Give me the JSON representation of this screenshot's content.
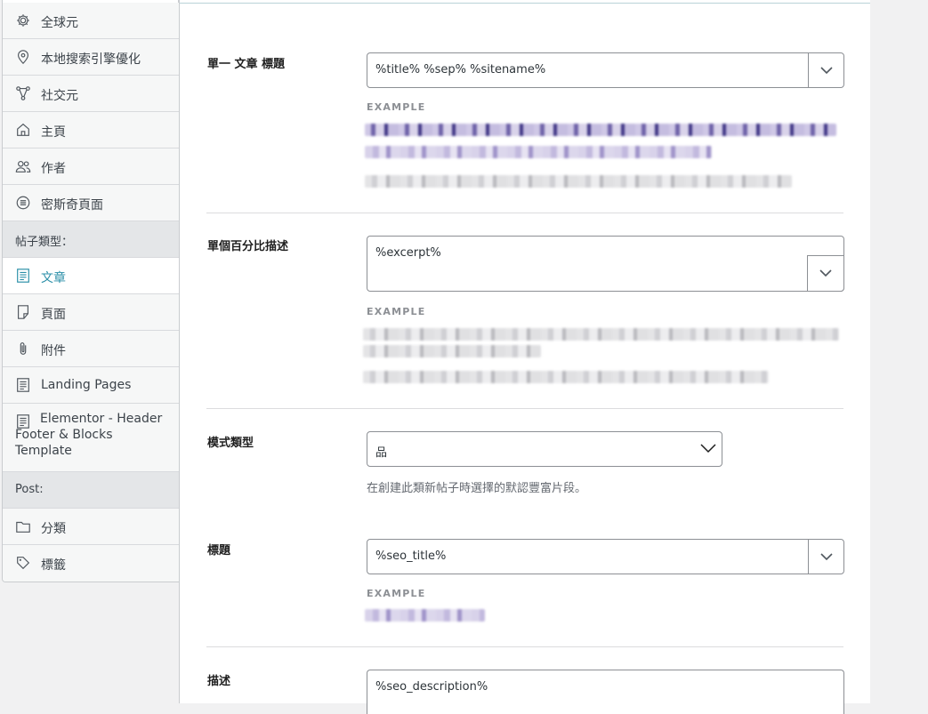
{
  "sidebar": {
    "items_top": [
      {
        "label": "全球元",
        "icon": "gear-icon"
      },
      {
        "label": "本地搜索引擎優化",
        "icon": "location-pin-icon"
      },
      {
        "label": "社交元",
        "icon": "share-nodes-icon"
      },
      {
        "label": "主頁",
        "icon": "home-icon"
      },
      {
        "label": "作者",
        "icon": "users-icon"
      },
      {
        "label": "密斯奇頁面",
        "icon": "circle-list-icon"
      }
    ],
    "section_post_types": "帖子類型：",
    "post_types": [
      {
        "label": "文章",
        "icon": "document-icon",
        "active": true
      },
      {
        "label": "頁面",
        "icon": "page-icon"
      },
      {
        "label": "附件",
        "icon": "paperclip-icon"
      },
      {
        "label": "Landing Pages",
        "icon": "document-icon"
      },
      {
        "label": "Elementor - Header Footer & Blocks Template",
        "icon": "document-icon"
      }
    ],
    "section_post": "Post:",
    "post_items": [
      {
        "label": "分類",
        "icon": "folder-icon"
      },
      {
        "label": "標籤",
        "icon": "tag-icon"
      }
    ]
  },
  "main": {
    "rows": [
      {
        "label": "單一 文章 標題",
        "value": "%title% %sep% %sitename%",
        "example_label": "EXAMPLE"
      },
      {
        "label": "單個百分比描述",
        "value": "%excerpt%",
        "example_label": "EXAMPLE"
      },
      {
        "label": "模式類型",
        "value": "品",
        "help": "在創建此類新帖子時選擇的默認豐富片段。"
      },
      {
        "label": "標題",
        "value": "%seo_title%",
        "example_label": "EXAMPLE"
      },
      {
        "label": "描述",
        "value": "%seo_description%"
      }
    ]
  },
  "colors": {
    "accent": "#2b8fa8",
    "border": "#8c8f94",
    "example_purple": "#9f93c9"
  }
}
